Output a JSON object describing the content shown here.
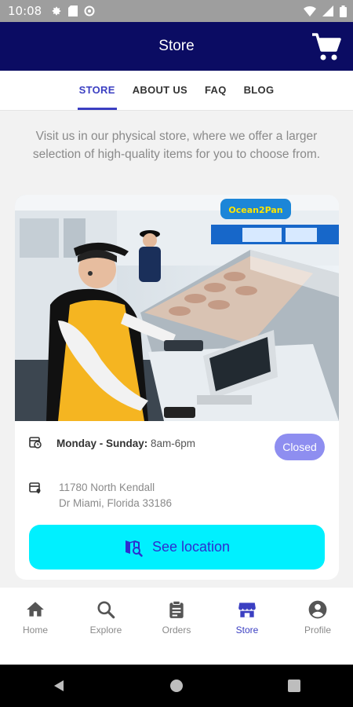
{
  "status_bar": {
    "time": "10:08"
  },
  "app_bar": {
    "title": "Store",
    "cart_icon": "cart-icon"
  },
  "tabs": [
    {
      "label": "STORE",
      "active": true
    },
    {
      "label": "ABOUT US",
      "active": false
    },
    {
      "label": "FAQ",
      "active": false
    },
    {
      "label": "BLOG",
      "active": false
    }
  ],
  "intro_text": "Visit us in our physical store, where we offer a larger selection of high-quality items for you to choose from.",
  "store_card": {
    "photo_sign": "Ocean2Pan",
    "hours_label": "Monday - Sunday:",
    "hours_value": "8am-6pm",
    "status_badge": "Closed",
    "address_line1": "11780 North Kendall",
    "address_line2": "Dr Miami, Florida 33186",
    "button_label": "See location"
  },
  "bottom_nav": [
    {
      "label": "Home",
      "icon": "home-icon",
      "active": false
    },
    {
      "label": "Explore",
      "icon": "search-icon",
      "active": false
    },
    {
      "label": "Orders",
      "icon": "orders-icon",
      "active": false
    },
    {
      "label": "Store",
      "icon": "store-icon",
      "active": true
    },
    {
      "label": "Profile",
      "icon": "profile-icon",
      "active": false
    }
  ],
  "colors": {
    "app_bar": "#0b0c63",
    "accent": "#3b3fc2",
    "button": "#00f0ff",
    "badge": "#8e8ef0"
  }
}
